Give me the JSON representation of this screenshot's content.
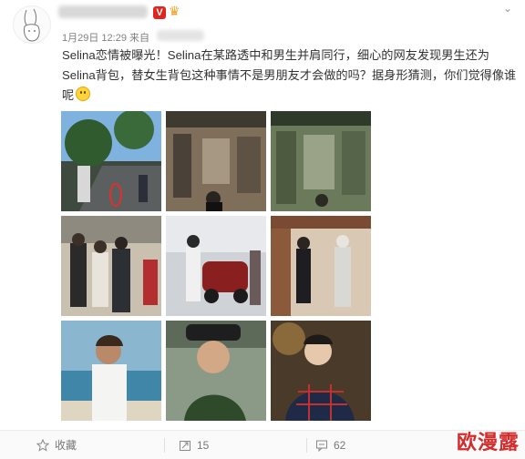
{
  "header": {
    "meta": "1月29日 12:29 来自",
    "verified_mark": "V"
  },
  "post": {
    "text": "Selina恋情被曝光！Selina在某路透中和男生并肩同行，细心的网友发现男生还为Selina背包，替女生背包这种事情不是男朋友才会做的吗？据身形猜测，你们觉得像谁呢"
  },
  "footer": {
    "favorite_label": "收藏",
    "repost_count": "15",
    "comment_count": "62"
  },
  "watermark": "欧漫露",
  "colors": {
    "verified": "#e0241f",
    "watermark": "#d42b2b",
    "meta": "#808080"
  },
  "icons": [
    "bunny-avatar",
    "star-icon",
    "repost-icon",
    "comment-icon",
    "smile-emoji",
    "chevron-down-icon"
  ]
}
